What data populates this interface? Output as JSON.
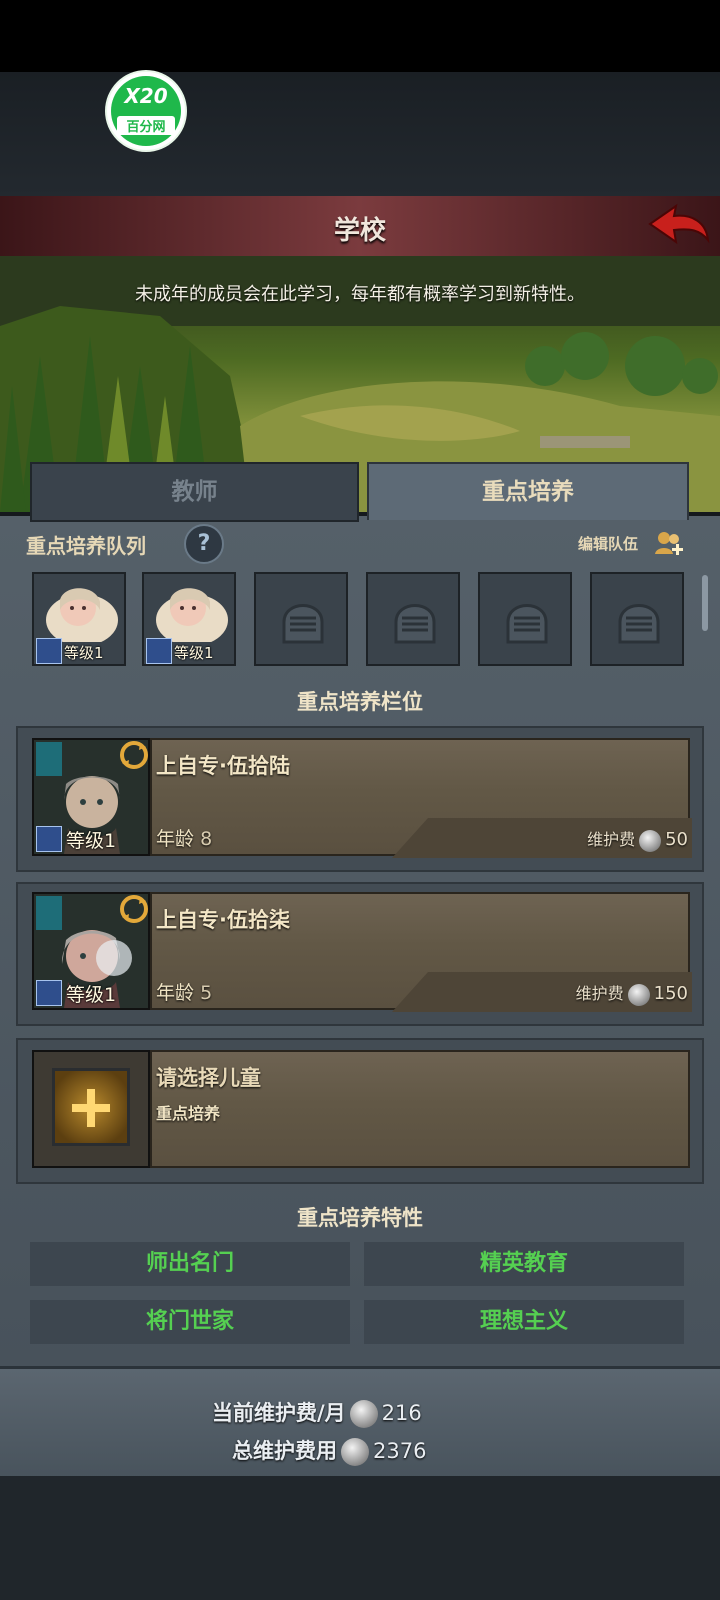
{
  "logo": {
    "line1": "X20",
    "line2": "百分网"
  },
  "header": {
    "title": "学校"
  },
  "banner": {
    "description": "未成年的成员会在此学习，每年都有概率学习到新特性。"
  },
  "tabs": [
    {
      "label": "教师",
      "active": false
    },
    {
      "label": "重点培养",
      "active": true
    }
  ],
  "queue": {
    "title": "重点培养队列",
    "help": "?",
    "edit_label": "编辑队伍",
    "slots": [
      {
        "type": "child",
        "level": "等级1"
      },
      {
        "type": "child",
        "level": "等级1"
      },
      {
        "type": "empty"
      },
      {
        "type": "empty"
      },
      {
        "type": "empty"
      },
      {
        "type": "empty"
      }
    ]
  },
  "slots_section": {
    "title": "重点培养栏位",
    "cards": [
      {
        "name": "上自专·伍拾陆",
        "age_label": "年龄",
        "age": "8",
        "level": "等级1",
        "fee_label": "维护费",
        "fee": "50"
      },
      {
        "name": "上自专·伍拾柒",
        "age_label": "年龄",
        "age": "5",
        "level": "等级1",
        "fee_label": "维护费",
        "fee": "150"
      }
    ],
    "empty_card": {
      "title": "请选择儿童",
      "subtitle": "重点培养"
    }
  },
  "traits": {
    "title": "重点培养特性",
    "items": [
      "师出名门",
      "精英教育",
      "将门世家",
      "理想主义"
    ]
  },
  "footer": {
    "monthly_label": "当前维护费/月",
    "monthly_value": "216",
    "total_label": "总维护费用",
    "total_value": "2376"
  },
  "colors": {
    "header_red": "#7b3b3e",
    "trait_green": "#55d051",
    "panel": "#556069"
  }
}
